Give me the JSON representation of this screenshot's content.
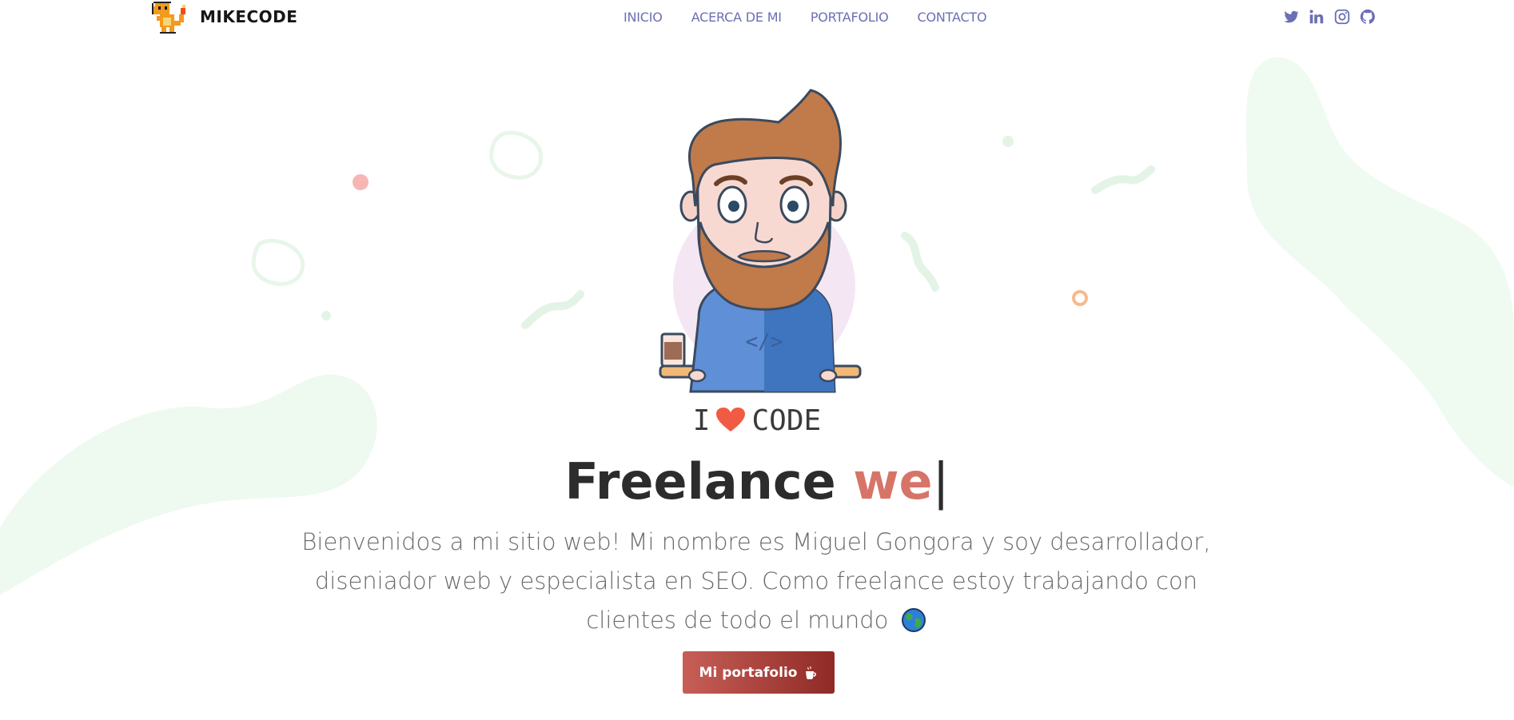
{
  "brand": {
    "name": "MIKECODE",
    "logo_icon": "charmander-pixel-icon"
  },
  "nav": {
    "items": [
      {
        "label": "INICIO"
      },
      {
        "label": "ACERCA DE MI"
      },
      {
        "label": "PORTAFOLIO"
      },
      {
        "label": "CONTACTO"
      }
    ]
  },
  "social": [
    "twitter-icon",
    "linkedin-icon",
    "instagram-icon",
    "github-icon"
  ],
  "hero": {
    "love_prefix": "I",
    "love_suffix": "CODE",
    "headline_static": "Freelance",
    "headline_typed": "we",
    "headline_cursor": "|",
    "intro_text": "Bienvenidos a mi sitio web! Mi nombre es Miguel Gongora y soy desarrollador, diseniador web y especialista en SEO. Como freelance estoy trabajando con clientes de todo el mundo",
    "cta_label": "Mi portafolio"
  },
  "colors": {
    "nav_link": "#6c6fb3",
    "accent": "#d77468",
    "cta_start": "#c75f57",
    "cta_end": "#8f2a26",
    "blob": "#e9f8ec"
  }
}
